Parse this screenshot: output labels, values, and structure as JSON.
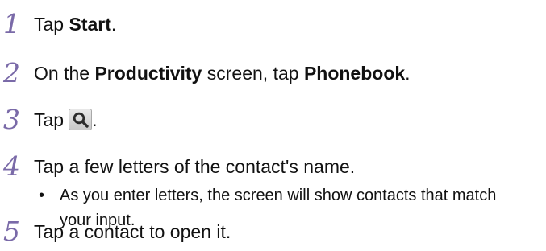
{
  "steps": [
    {
      "number": "1",
      "pre": "Tap ",
      "bold": "Start",
      "post": "."
    },
    {
      "number": "2",
      "pre": "On the ",
      "bold1": "Productivity",
      "mid": " screen, tap ",
      "bold2": "Phonebook",
      "post": "."
    },
    {
      "number": "3",
      "pre": "Tap",
      "icon": "search-icon",
      "post": "."
    },
    {
      "number": "4",
      "text": "Tap a few letters of the contact's name.",
      "bullet": "•",
      "bullet_text": "As you enter letters, the screen will show contacts that match your input."
    },
    {
      "number": "5",
      "text": "Tap a contact to open it."
    }
  ],
  "colors": {
    "step_number": "#7a6aa8",
    "text": "#111111"
  }
}
